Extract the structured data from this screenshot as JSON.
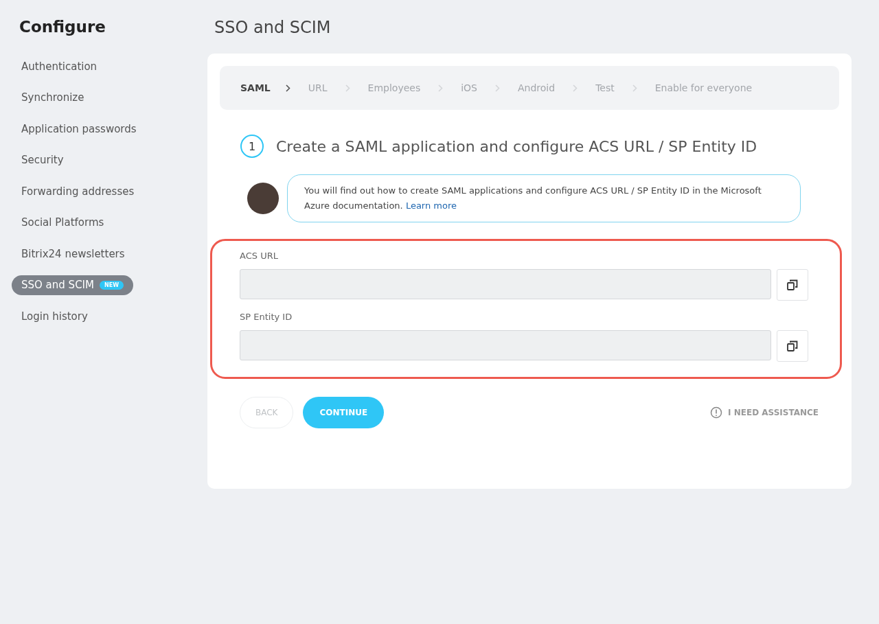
{
  "sidebar": {
    "title": "Configure",
    "items": [
      {
        "label": "Authentication",
        "selected": false
      },
      {
        "label": "Synchronize",
        "selected": false
      },
      {
        "label": "Application passwords",
        "selected": false
      },
      {
        "label": "Security",
        "selected": false
      },
      {
        "label": "Forwarding addresses",
        "selected": false
      },
      {
        "label": "Social Platforms",
        "selected": false
      },
      {
        "label": "Bitrix24 newsletters",
        "selected": false
      },
      {
        "label": "SSO and SCIM",
        "selected": true,
        "badge": "NEW"
      },
      {
        "label": "Login history",
        "selected": false
      }
    ]
  },
  "page_title": "SSO and SCIM",
  "steps": [
    {
      "label": "SAML",
      "selected": true
    },
    {
      "label": "URL",
      "selected": false
    },
    {
      "label": "Employees",
      "selected": false
    },
    {
      "label": "iOS",
      "selected": false
    },
    {
      "label": "Android",
      "selected": false
    },
    {
      "label": "Test",
      "selected": false
    },
    {
      "label": "Enable for everyone",
      "selected": false
    }
  ],
  "section": {
    "number": "1",
    "title": "Create a SAML application and configure ACS URL / SP Entity ID"
  },
  "hint": {
    "text": "You will find out how to create SAML applications and configure ACS URL / SP Entity ID in the Microsoft Azure documentation.",
    "link": "Learn more"
  },
  "fields": [
    {
      "label": "ACS URL"
    },
    {
      "label": "SP Entity ID"
    }
  ],
  "buttons": {
    "back": "BACK",
    "continue": "CONTINUE",
    "help": "I NEED ASSISTANCE"
  }
}
